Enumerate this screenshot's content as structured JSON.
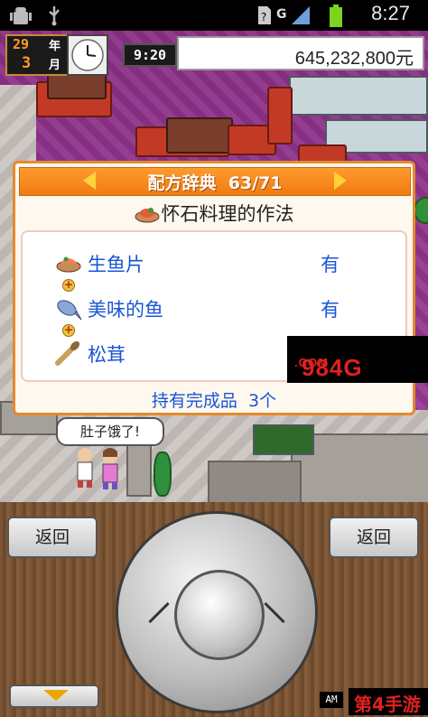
{
  "status_bar": {
    "time": "8:27",
    "network": "G"
  },
  "hud": {
    "year_value": "29",
    "year_label": "年",
    "month_value": "3",
    "month_label": "月",
    "game_time": "9:20",
    "money": "645,232,800元"
  },
  "speech_bubble": "肚子饿了!",
  "dialog": {
    "header_title": "配方辞典",
    "header_count": "63/71",
    "recipe_name": "怀石料理的作法",
    "ingredients": [
      {
        "name": "生鱼片",
        "status": "有"
      },
      {
        "name": "美味的鱼",
        "status": "有"
      },
      {
        "name": "松茸",
        "status": ""
      }
    ],
    "completed_text": "持有完成品",
    "completed_count": "3个"
  },
  "watermark": {
    "text": "984G",
    "suffix": ".COM"
  },
  "controls": {
    "back_left": "返回",
    "back_right": "返回",
    "am_label": "AM"
  },
  "logo": {
    "text": "第4手游"
  },
  "colors": {
    "dialog_border": "#e48a2c",
    "header_orange": "#f07a12",
    "ingredient_blue": "#1a55d8",
    "money_bg": "#ffffff",
    "floor_purple": "#9b3b97"
  }
}
